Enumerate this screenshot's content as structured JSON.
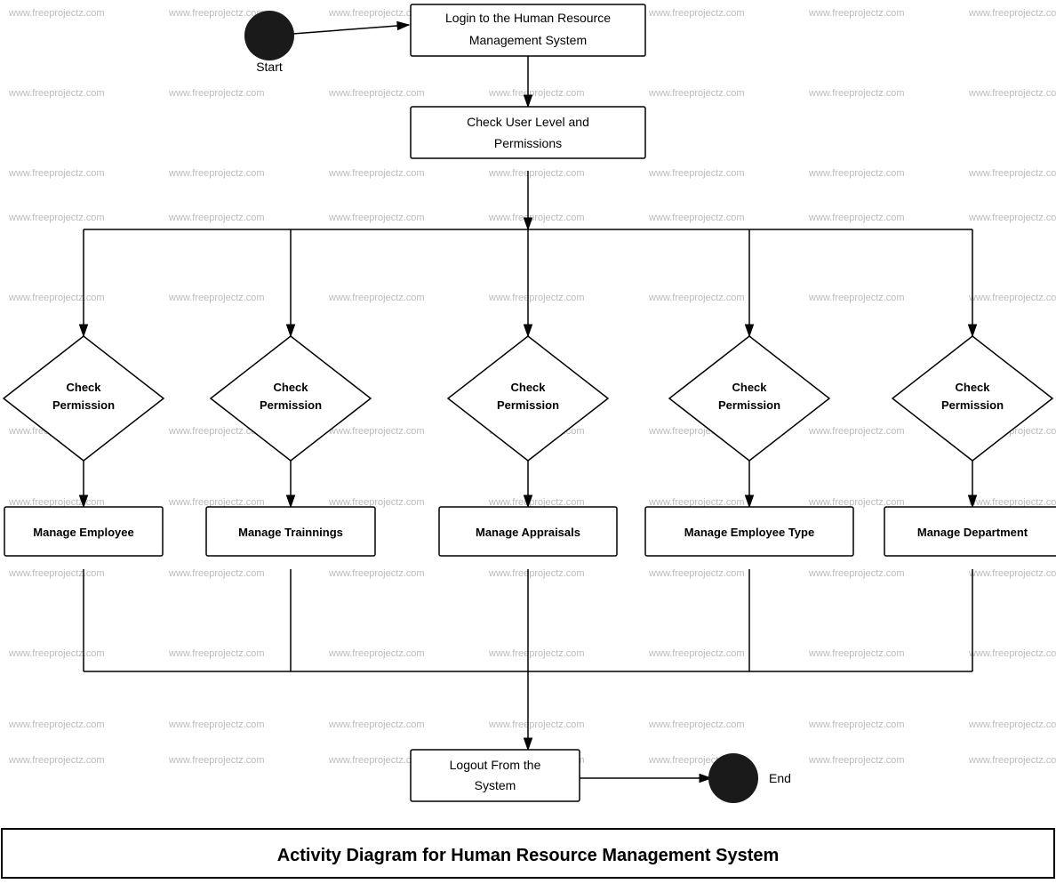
{
  "diagram": {
    "title": "Activity Diagram for Human Resource Management System",
    "watermark": "www.freeprojectz.com",
    "nodes": {
      "start": {
        "label": "Start",
        "type": "circle"
      },
      "end": {
        "label": "End",
        "type": "circle"
      },
      "login": {
        "label": "Login to the Human Resource\nManagement System",
        "type": "rectangle"
      },
      "check_user": {
        "label": "Check User Level and\nPermissions",
        "type": "rectangle"
      },
      "logout": {
        "label": "Logout From the\nSystem",
        "type": "rectangle"
      },
      "check_perm1": {
        "label": "Check\nPermission",
        "type": "diamond"
      },
      "check_perm2": {
        "label": "Check\nPermission",
        "type": "diamond"
      },
      "check_perm3": {
        "label": "Check\nPermission",
        "type": "diamond"
      },
      "check_perm4": {
        "label": "Check\nPermission",
        "type": "diamond"
      },
      "check_perm5": {
        "label": "Check\nPermission",
        "type": "diamond"
      },
      "manage_employee": {
        "label": "Manage Employee",
        "type": "rectangle"
      },
      "manage_trainings": {
        "label": "Manage Trainnings",
        "type": "rectangle"
      },
      "manage_appraisals": {
        "label": "Manage Appraisals",
        "type": "rectangle"
      },
      "manage_employee_type": {
        "label": "Manage Employee Type",
        "type": "rectangle"
      },
      "manage_department": {
        "label": "Manage Department",
        "type": "rectangle"
      }
    }
  }
}
